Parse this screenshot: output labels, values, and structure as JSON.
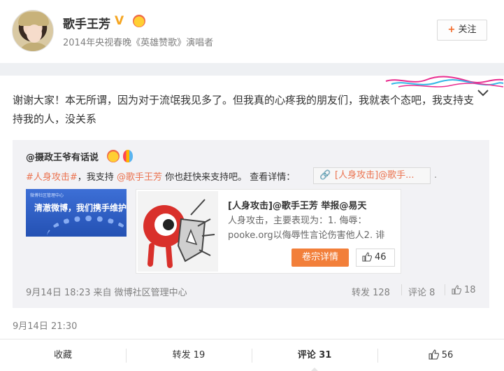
{
  "profile": {
    "name": "歌手王芳",
    "verified_mark": "V",
    "description": "2014年央视春晚《英雄赞歌》演唱者",
    "follow_label": "关注",
    "avatar_icon": "avatar-image"
  },
  "post": {
    "text": "谢谢大家！本无所谓，因为对于流氓我见多了。但我真的心疼我的朋友们，我就表个态吧，我支持支持我的人，没关系",
    "time": "9月14日 21:30"
  },
  "repost": {
    "author": "@摄政王爷有话说",
    "topic": "#人身攻击#",
    "text_a": "，我支持 ",
    "mention": "@歌手王芳",
    "text_b": " 你也赶快来支持吧。 查看详情：",
    "detail_link": "[人身攻击]@歌手...",
    "trailing": ".",
    "banner_title": "清澈微博，我们携手维护！",
    "banner_small": "微博社区管理中心",
    "card": {
      "title": "[人身攻击]@歌手王芳 举报@易天",
      "desc": "人身攻击，主要表现为：1. 侮辱：pooke.org以侮辱性言论伤害他人2. 诽",
      "button": "卷宗详情",
      "likes": "46"
    },
    "time_source": "9月14日 18:23 来自 微博社区管理中心",
    "forward": "转发 128",
    "comment": "评论 8",
    "likes": "18"
  },
  "actions": {
    "favorite": "收藏",
    "forward": "转发 19",
    "comment": "评论 31",
    "likes": "56"
  },
  "colors": {
    "link": "#eb7350",
    "button": "#f27f3a",
    "verified": "#f5a623"
  }
}
